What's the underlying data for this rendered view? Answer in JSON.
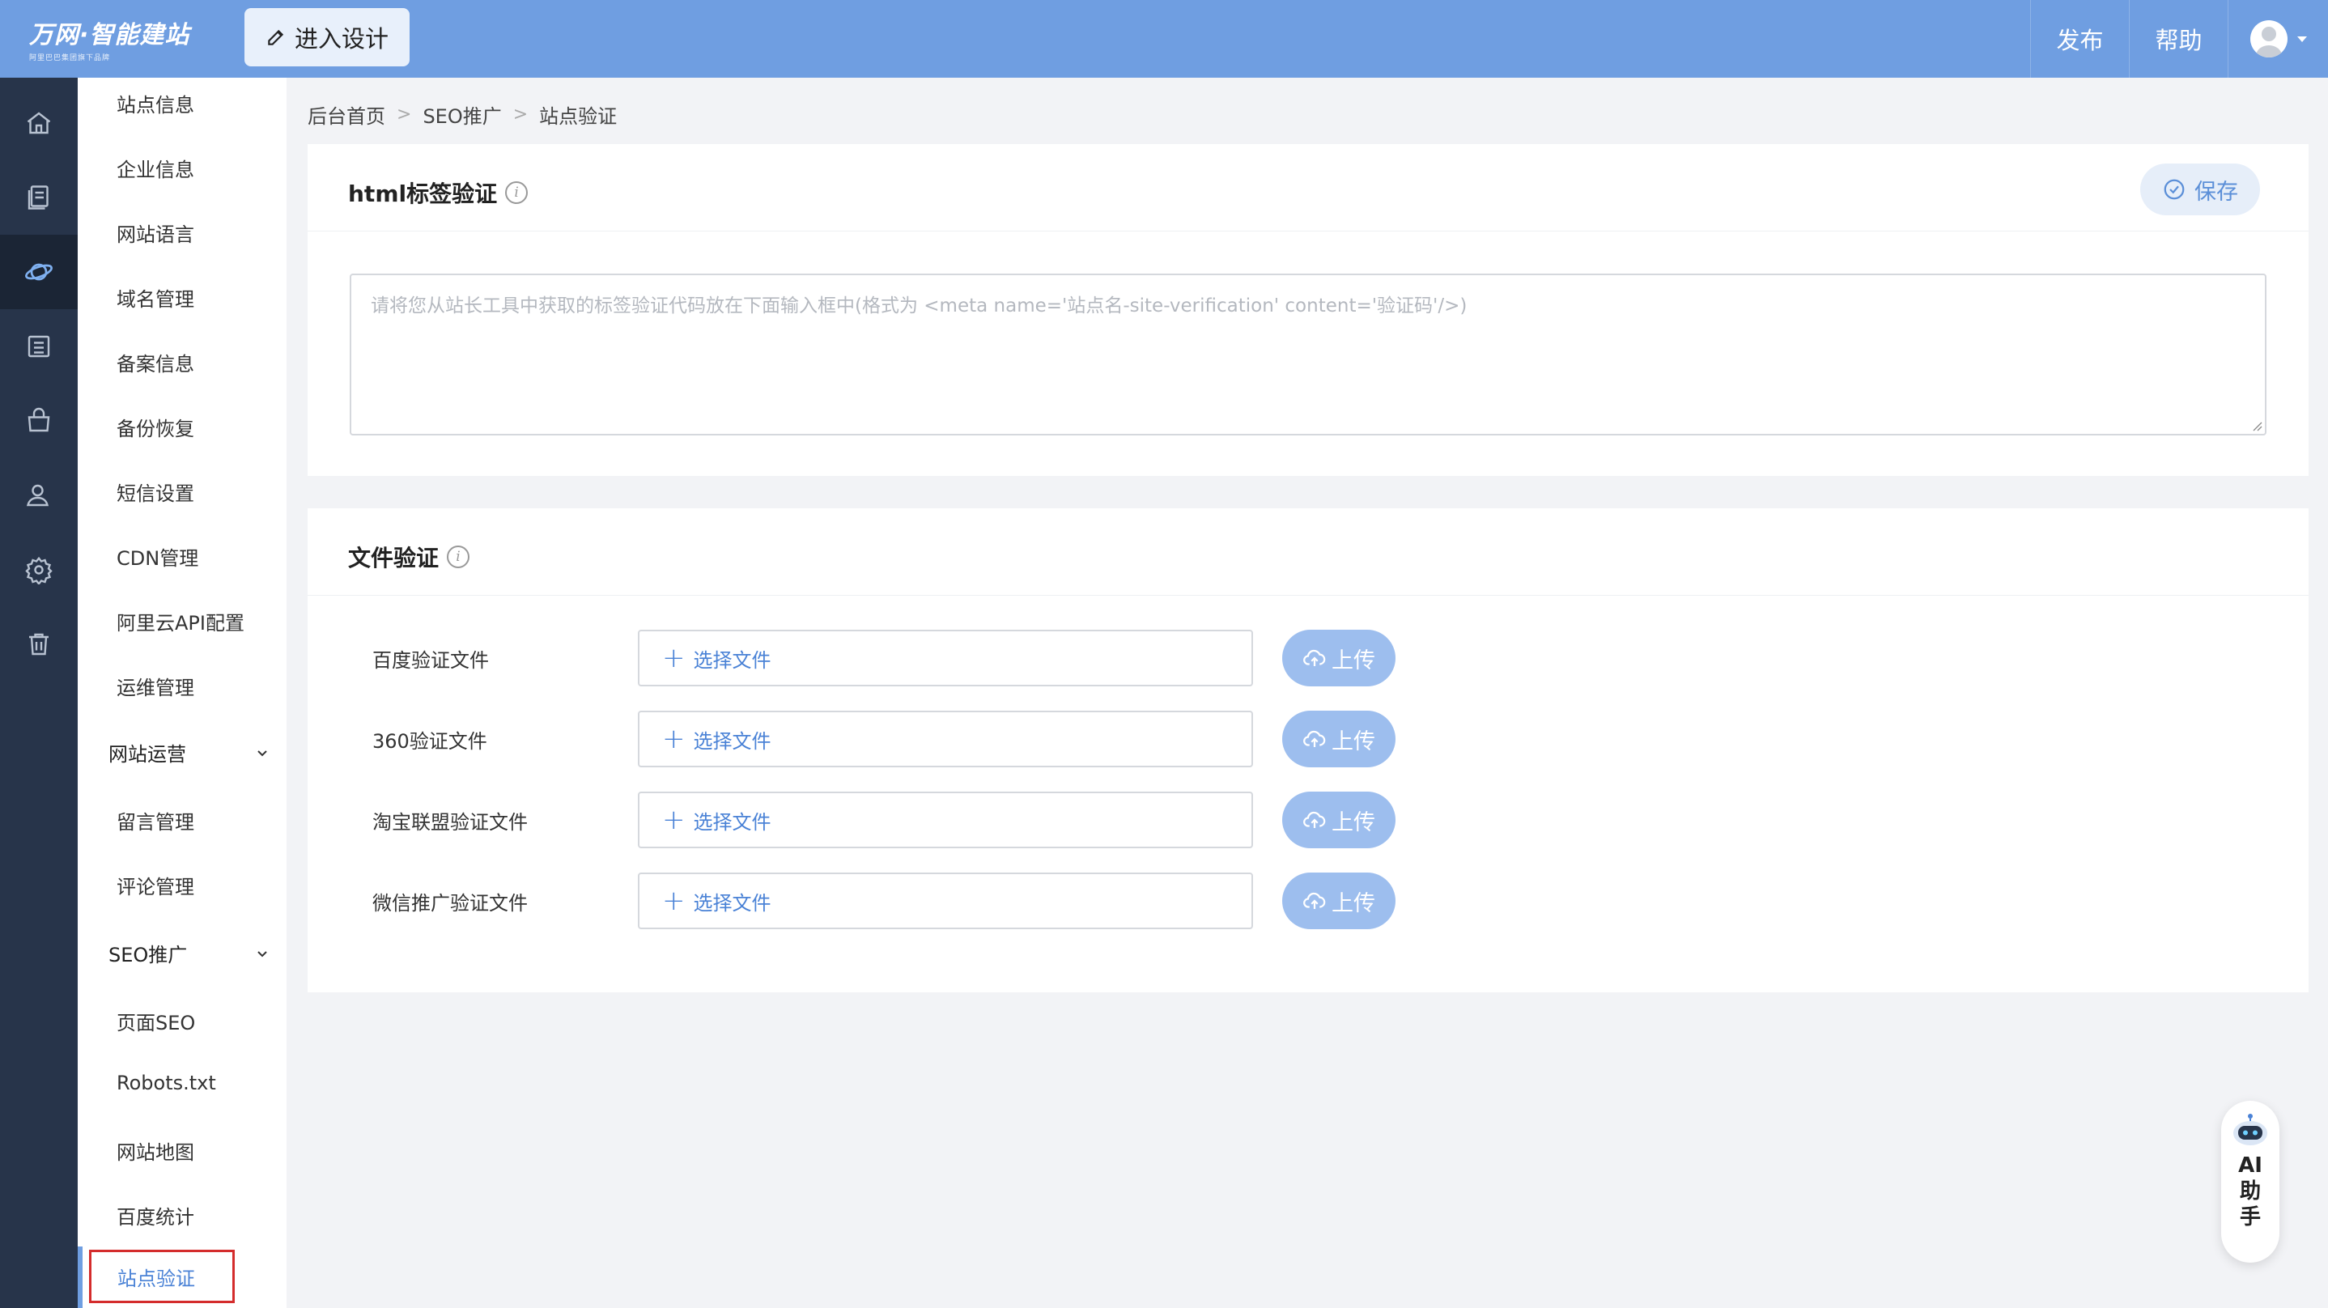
{
  "header": {
    "logo_text": "万网·智能建站",
    "logo_sub": "阿里巴巴集团旗下品牌",
    "design_button": "进入设计",
    "publish": "发布",
    "help": "帮助"
  },
  "rail": {
    "icons": [
      "home-icon",
      "pages-icon",
      "seo-planet-icon",
      "list-icon",
      "shop-bag-icon",
      "user-icon",
      "gear-icon",
      "trash-icon"
    ],
    "active_index": 2
  },
  "submenu": {
    "items_top": [
      "站点信息",
      "企业信息",
      "网站语言",
      "域名管理",
      "备案信息",
      "备份恢复",
      "短信设置",
      "CDN管理",
      "阿里云API配置",
      "运维管理"
    ],
    "group_ops": "网站运营",
    "items_ops": [
      "留言管理",
      "评论管理"
    ],
    "group_seo": "SEO推广",
    "items_seo": [
      "页面SEO",
      "Robots.txt",
      "网站地图",
      "百度统计"
    ],
    "active_item": "站点验证"
  },
  "breadcrumb": [
    "后台首页",
    "SEO推广",
    "站点验证"
  ],
  "html_verify": {
    "title": "html标签验证",
    "save_label": "保存",
    "placeholder": "请将您从站长工具中获取的标签验证代码放在下面输入框中(格式为 <meta name='站点名-site-verification' content='验证码'/>)"
  },
  "file_verify": {
    "title": "文件验证",
    "choose_label": "选择文件",
    "upload_label": "上传",
    "rows": [
      "百度验证文件",
      "360验证文件",
      "淘宝联盟验证文件",
      "微信推广验证文件"
    ]
  },
  "ai_assistant": {
    "label": "AI助手"
  },
  "colors": {
    "topbar": "#6f9ee1",
    "rail": "#27344a",
    "accent": "#4a82d6",
    "upload_button": "#9dbeee",
    "highlight_border": "#d42c2c"
  }
}
